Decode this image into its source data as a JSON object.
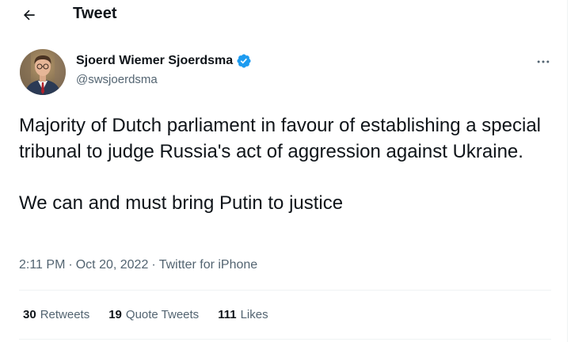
{
  "header": {
    "back_icon": "arrow-left-icon",
    "title": "Tweet"
  },
  "author": {
    "name": "Sjoerd Wiemer Sjoerdsma",
    "handle": "@swsjoerdsma",
    "verified_icon": "verified-badge-icon",
    "verified_color": "#1d9bf0"
  },
  "more_icon": "more-horizontal-icon",
  "tweet": {
    "paragraphs": [
      "Majority of Dutch parliament in favour of establishing a special tribunal to judge Russia's act of aggression against Ukraine.",
      "We can and must bring Putin to justice"
    ]
  },
  "meta": {
    "time": "2:11 PM",
    "separator1": "·",
    "date": "Oct 20, 2022",
    "separator2": "·",
    "source": "Twitter for iPhone"
  },
  "stats": {
    "retweets_count": "30",
    "retweets_label": "Retweets",
    "quotes_count": "19",
    "quotes_label": "Quote Tweets",
    "likes_count": "111",
    "likes_label": "Likes"
  },
  "colors": {
    "text_primary": "#0f1419",
    "text_secondary": "#536471",
    "divider": "#eff3f4"
  }
}
